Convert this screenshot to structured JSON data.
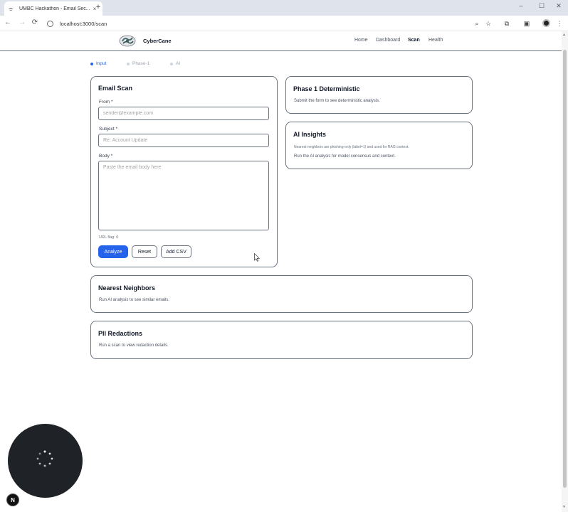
{
  "browser": {
    "tab_title": "UMBC Hackathon - Email Sec...",
    "tab_close": "×",
    "new_tab": "+",
    "url": "localhost:3000/scan",
    "back": "←",
    "forward": "→",
    "reload": "⟳",
    "minimize": "–",
    "maximize": "☐",
    "close": "✕",
    "zoom_icon": "⌕",
    "star_icon": "☆",
    "extensions_icon": "⧉",
    "sidepanel_icon": "▣",
    "menu_icon": "⋮"
  },
  "header": {
    "brand": "CyberCane",
    "nav": [
      {
        "label": "Home"
      },
      {
        "label": "Dashboard"
      },
      {
        "label": "Scan"
      },
      {
        "label": "Health"
      }
    ]
  },
  "stepper": [
    {
      "label": "Input"
    },
    {
      "label": "Phase-1"
    },
    {
      "label": "AI"
    }
  ],
  "email_scan": {
    "title": "Email Scan",
    "from_label": "From *",
    "from_placeholder": "sender@example.com",
    "subject_label": "Subject *",
    "subject_placeholder": "Re: Account Update",
    "body_label": "Body *",
    "body_placeholder": "Paste the email body here",
    "url_flag": "URL flag: 0",
    "analyze": "Analyze",
    "reset": "Reset",
    "add_csv": "Add CSV"
  },
  "phase1": {
    "title": "Phase 1 Deterministic",
    "text": "Submit the form to see deterministic analysis."
  },
  "ai_insights": {
    "title": "AI Insights",
    "note": "Nearest neighbors are phishing-only (label=1) and used for RAG context.",
    "text": "Run the AI analysis for model consensus and context."
  },
  "neighbors": {
    "title": "Nearest Neighbors",
    "text": "Run AI analysis to see similar emails."
  },
  "pii": {
    "title": "PII Redactions",
    "text": "Run a scan to view redaction details."
  },
  "devtools": {
    "badge": "N"
  },
  "colors": {
    "primary": "#2563eb",
    "border": "#6b7280",
    "widget": "#1f2226"
  }
}
